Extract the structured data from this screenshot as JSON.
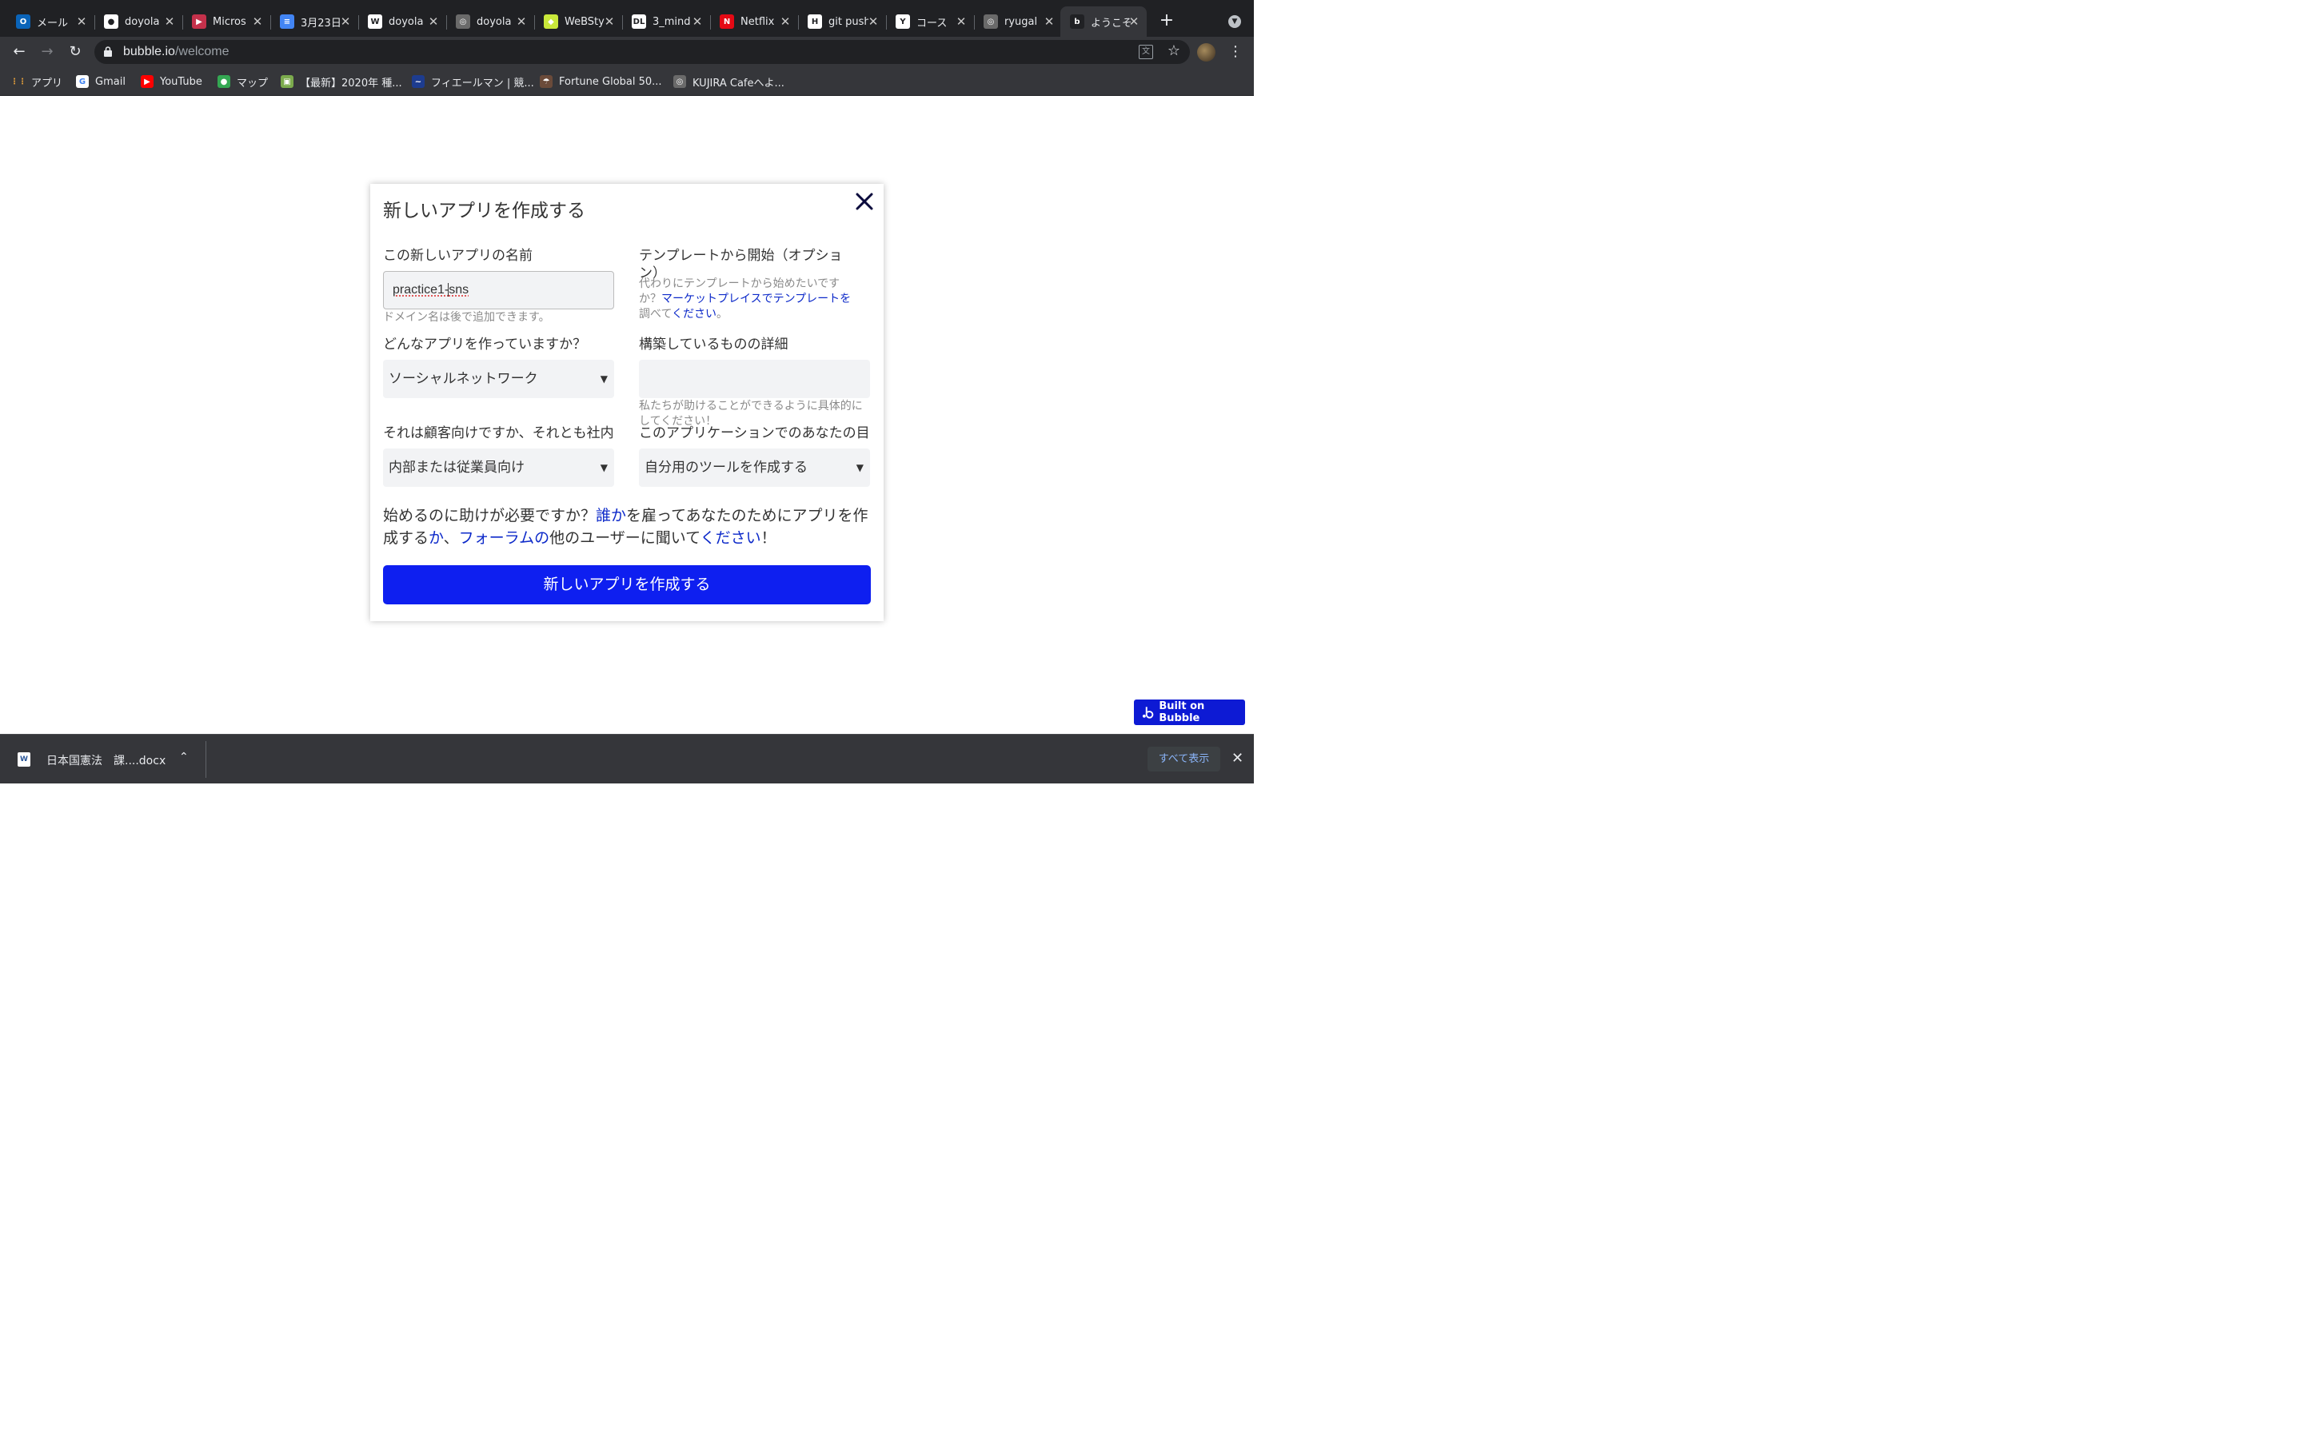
{
  "browser": {
    "tabs": [
      {
        "title": "メール",
        "icon": "outlook-icon",
        "color": "#0a64b9",
        "glyph": "O"
      },
      {
        "title": "doyola",
        "icon": "github-icon",
        "color": "#ffffff",
        "glyph": "●"
      },
      {
        "title": "Micros",
        "icon": "stream-icon",
        "color": "#c4314b",
        "glyph": "▶"
      },
      {
        "title": "3月23日",
        "icon": "google-docs-icon",
        "color": "#4285f4",
        "glyph": "≡"
      },
      {
        "title": "doyola",
        "icon": "wordpress-icon",
        "color": "#ffffff",
        "glyph": "W"
      },
      {
        "title": "doyola",
        "icon": "globe-icon",
        "color": "#6a6a6a",
        "glyph": "◎"
      },
      {
        "title": "WeBStyle",
        "icon": "webstyle-icon",
        "color": "#c9e83a",
        "glyph": "◆"
      },
      {
        "title": "3_mind",
        "icon": "dl-icon",
        "color": "#ffffff",
        "glyph": "DL"
      },
      {
        "title": "Netflix",
        "icon": "netflix-icon",
        "color": "#e50914",
        "glyph": "N"
      },
      {
        "title": "git push",
        "icon": "hatena-icon",
        "color": "#ffffff",
        "glyph": "H"
      },
      {
        "title": "コース",
        "icon": "course-icon",
        "color": "#ffffff",
        "glyph": "Y"
      },
      {
        "title": "ryugal",
        "icon": "globe-icon",
        "color": "#6a6a6a",
        "glyph": "◎"
      },
      {
        "title": "ようこそ",
        "icon": "bubble-icon",
        "color": "#202124",
        "glyph": "b"
      }
    ],
    "url_domain": "bubble.io",
    "url_path": "/welcome",
    "bookmarks": [
      {
        "label": "アプリ",
        "icon": "apps-grid-icon",
        "color": "#e8eaed",
        "glyph": "⋮⋮"
      },
      {
        "label": "Gmail",
        "icon": "google-icon",
        "color": "#ffffff",
        "glyph": "G"
      },
      {
        "label": "YouTube",
        "icon": "youtube-icon",
        "color": "#ff0000",
        "glyph": "▶"
      },
      {
        "label": "マップ",
        "icon": "maps-pin-icon",
        "color": "#34a853",
        "glyph": "●"
      },
      {
        "label": "【最新】2020年 種...",
        "icon": "site-icon",
        "color": "#7cab4d",
        "glyph": "▣"
      },
      {
        "label": "フィエールマン | 競...",
        "icon": "keiba-icon",
        "color": "#1d3c8f",
        "glyph": "~"
      },
      {
        "label": "Fortune Global 50...",
        "icon": "fortune-icon",
        "color": "#6b4b3a",
        "glyph": "☂"
      },
      {
        "label": "KUJIRA Cafeへよ...",
        "icon": "globe-icon",
        "color": "#6a6a6a",
        "glyph": "◎"
      }
    ]
  },
  "modal": {
    "title": "新しいアプリを作成する",
    "name_label": "この新しいアプリの名前",
    "name_value_a": "practice1-",
    "name_value_b": "sns",
    "name_help": "ドメイン名は後で追加できます。",
    "template_label": "テンプレートから開始（オプション）",
    "template_help_prefix": "代わりにテンプレートから始めたいですか？",
    "template_help_link": "マーケットプレイスでテンプレートを",
    "template_help_mid": "調べて",
    "template_help_link2": "ください",
    "template_help_suffix": "。",
    "app_type_label": "どんなアプリを作っていますか？",
    "app_type_value": "ソーシャルネットワーク",
    "details_label": "構築しているものの詳細",
    "details_value": "",
    "details_help": "私たちが助けることができるように具体的にしてください！",
    "audience_label": "それは顧客向けですか、それとも社内ですか？",
    "audience_value": "内部または従業員向け",
    "goal_label": "このアプリケーションでのあなたの目標は何ですか？",
    "goal_value": "自分用のツールを作成する",
    "help_text": {
      "p1": "始めるのに助けが必要ですか？",
      "l1": "誰か",
      "p2": "を雇ってあなたのためにアプリを作成する",
      "l2": "か",
      "p3": "、",
      "l3": "フォーラムの",
      "p4": "他のユーザーに聞いて",
      "l4": "ください",
      "p5": "！"
    },
    "create_button": "新しいアプリを作成する"
  },
  "badge": {
    "label": "Built on Bubble"
  },
  "download": {
    "file_name": "日本国憲法　課....docx",
    "show_all": "すべて表示"
  },
  "colors": {
    "primary_button": "#0e1ff0",
    "link": "#0c29c9",
    "badge": "#0d1ad4",
    "chrome_dark": "#202124",
    "chrome_toolbar": "#35363a"
  }
}
